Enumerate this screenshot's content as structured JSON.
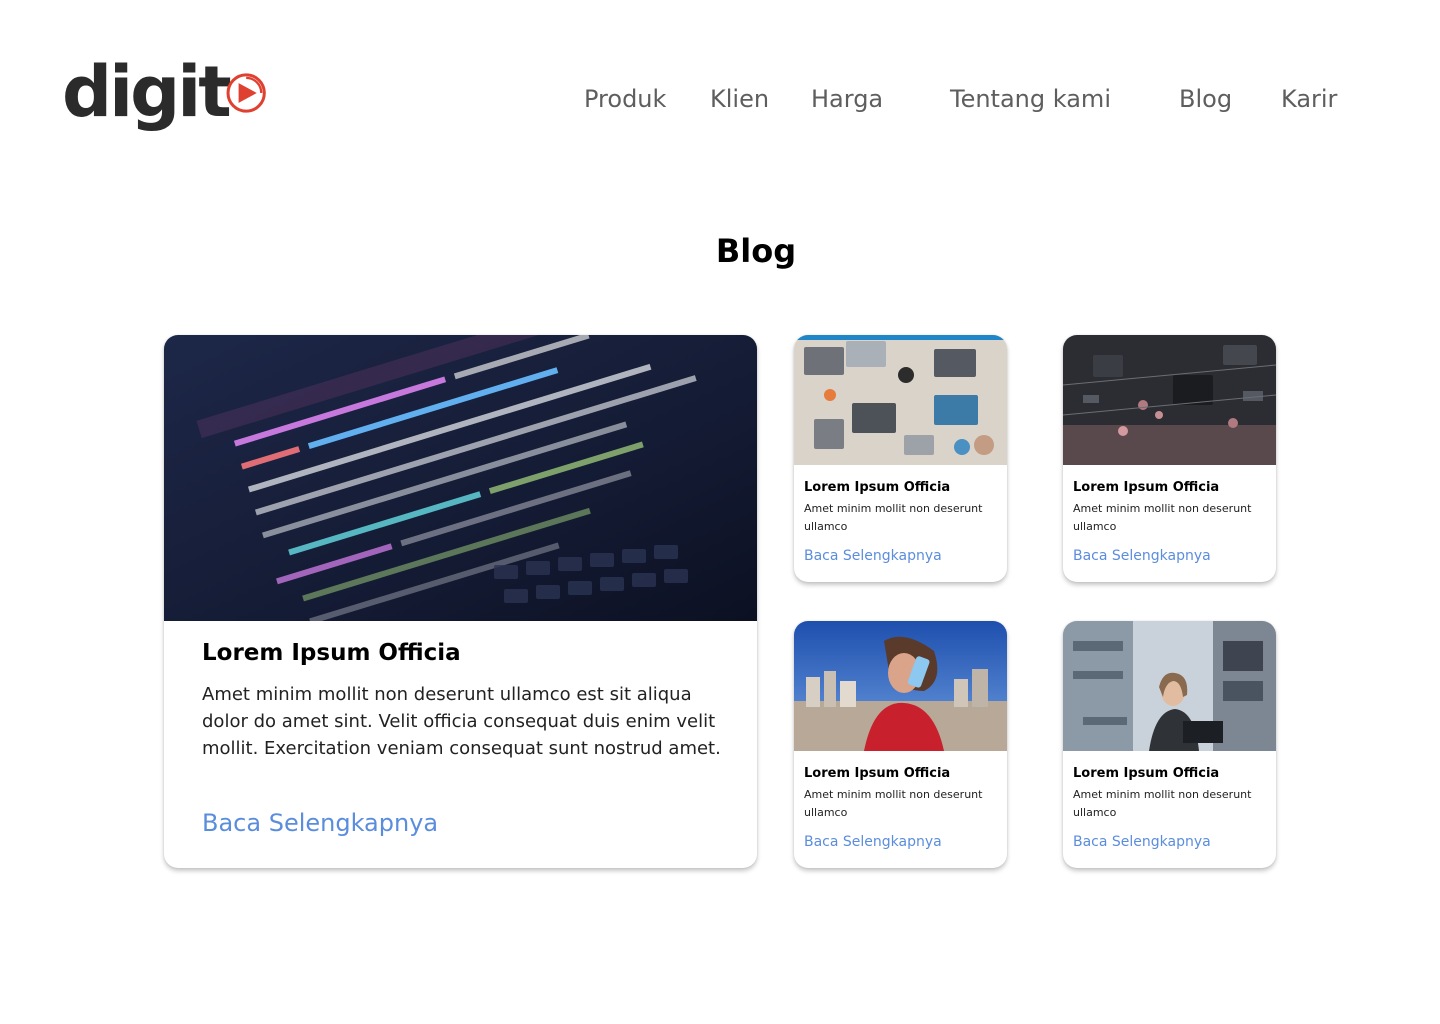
{
  "brand": {
    "logo_text": "digit",
    "accent": "#e0402f",
    "logo_color": "#2b2b2b"
  },
  "nav": {
    "items": [
      "Produk",
      "Klien",
      "Harga",
      "Tentang kami",
      "Blog",
      "Karir"
    ]
  },
  "page": {
    "title": "Blog"
  },
  "link_color": "#5b8ddd",
  "featured_post": {
    "title": "Lorem Ipsum Officia",
    "excerpt": "Amet minim mollit non deserunt ullamco est sit aliqua dolor do amet sint. Velit officia consequat duis enim velit mollit. Exercitation veniam consequat sunt nostrud amet.",
    "read_more": "Baca Selengkapnya",
    "image": "code-on-laptop-screen"
  },
  "posts": [
    {
      "title": "Lorem Ipsum Officia",
      "excerpt": "Amet minim mollit non deserunt ullamco",
      "read_more": "Baca Selengkapnya",
      "image": "team-laptops-desk"
    },
    {
      "title": "Lorem Ipsum Officia",
      "excerpt": "Amet minim mollit non deserunt ullamco",
      "read_more": "Baca Selengkapnya",
      "image": "circuit-board"
    },
    {
      "title": "Lorem Ipsum Officia",
      "excerpt": "Amet minim mollit non deserunt ullamco",
      "read_more": "Baca Selengkapnya",
      "image": "woman-on-phone-city"
    },
    {
      "title": "Lorem Ipsum Officia",
      "excerpt": "Amet minim mollit non deserunt ullamco",
      "read_more": "Baca Selengkapnya",
      "image": "woman-in-lab"
    }
  ]
}
